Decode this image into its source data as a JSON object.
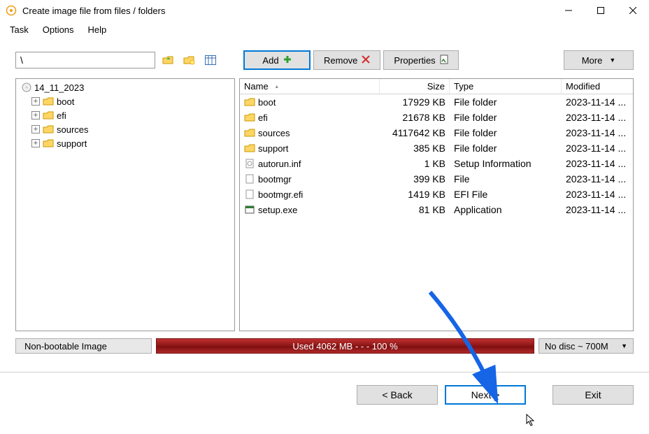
{
  "window": {
    "title": "Create image file from files / folders"
  },
  "menu": {
    "task": "Task",
    "options": "Options",
    "help": "Help"
  },
  "top": {
    "path": "\\",
    "add": "Add",
    "remove": "Remove",
    "properties": "Properties",
    "more": "More"
  },
  "tree": {
    "root": "14_11_2023",
    "nodes": [
      {
        "label": "boot"
      },
      {
        "label": "efi"
      },
      {
        "label": "sources"
      },
      {
        "label": "support"
      }
    ]
  },
  "list": {
    "headers": {
      "name": "Name",
      "size": "Size",
      "type": "Type",
      "modified": "Modified"
    },
    "rows": [
      {
        "icon": "folder",
        "name": "boot",
        "size": "17929 KB",
        "type": "File folder",
        "modified": "2023-11-14 ..."
      },
      {
        "icon": "folder",
        "name": "efi",
        "size": "21678 KB",
        "type": "File folder",
        "modified": "2023-11-14 ..."
      },
      {
        "icon": "folder",
        "name": "sources",
        "size": "4117642 KB",
        "type": "File folder",
        "modified": "2023-11-14 ..."
      },
      {
        "icon": "folder",
        "name": "support",
        "size": "385 KB",
        "type": "File folder",
        "modified": "2023-11-14 ..."
      },
      {
        "icon": "inf",
        "name": "autorun.inf",
        "size": "1 KB",
        "type": "Setup Information",
        "modified": "2023-11-14 ..."
      },
      {
        "icon": "file",
        "name": "bootmgr",
        "size": "399 KB",
        "type": "File",
        "modified": "2023-11-14 ..."
      },
      {
        "icon": "file",
        "name": "bootmgr.efi",
        "size": "1419 KB",
        "type": "EFI File",
        "modified": "2023-11-14 ..."
      },
      {
        "icon": "exe",
        "name": "setup.exe",
        "size": "81 KB",
        "type": "Application",
        "modified": "2023-11-14 ..."
      }
    ]
  },
  "status": {
    "label": "Non-bootable Image",
    "text": "Used  4062 MB  - - -  100 %",
    "select": "No disc ~ 700M"
  },
  "footer": {
    "back": "< Back",
    "next": "Next >",
    "exit": "Exit"
  }
}
